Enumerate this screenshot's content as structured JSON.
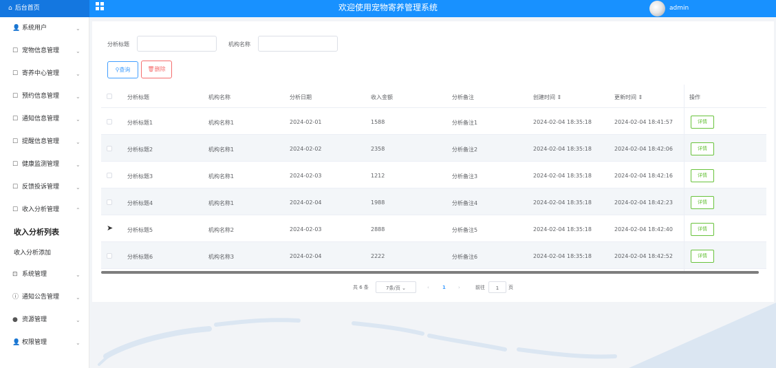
{
  "header": {
    "home_label": "后台首页",
    "title": "欢迎使用宠物寄养管理系统",
    "user": "admin"
  },
  "sidebar": {
    "items": [
      {
        "label": "系统用户",
        "icon": "user-icon",
        "glyph": "👤",
        "expanded": false
      },
      {
        "label": "宠物信息管理",
        "icon": "document-icon",
        "glyph": "☐",
        "expanded": false
      },
      {
        "label": "寄养中心管理",
        "icon": "document-icon",
        "glyph": "☐",
        "expanded": false
      },
      {
        "label": "预约信息管理",
        "icon": "document-icon",
        "glyph": "☐",
        "expanded": false
      },
      {
        "label": "通知信息管理",
        "icon": "document-icon",
        "glyph": "☐",
        "expanded": false
      },
      {
        "label": "提醒信息管理",
        "icon": "document-icon",
        "glyph": "☐",
        "expanded": false
      },
      {
        "label": "健康监测管理",
        "icon": "document-icon",
        "glyph": "☐",
        "expanded": false
      },
      {
        "label": "反馈投诉管理",
        "icon": "document-icon",
        "glyph": "☐",
        "expanded": false
      },
      {
        "label": "收入分析管理",
        "icon": "document-icon",
        "glyph": "☐",
        "expanded": true
      },
      {
        "label": "系统管理",
        "icon": "picture-icon",
        "glyph": "⊡",
        "expanded": false
      },
      {
        "label": "通知公告管理",
        "icon": "info-icon",
        "glyph": "ⓘ",
        "expanded": false
      },
      {
        "label": "资源管理",
        "icon": "location-icon",
        "glyph": "●",
        "expanded": false
      },
      {
        "label": "权限管理",
        "icon": "user-icon",
        "glyph": "👤",
        "expanded": false
      }
    ],
    "sub_items": [
      {
        "label": "收入分析列表",
        "active": true
      },
      {
        "label": "收入分析添加",
        "active": false
      }
    ],
    "chev_down": "⌄",
    "chev_up": "⌃"
  },
  "search": {
    "title_label": "分析标题",
    "title_value": "",
    "org_label": "机构名称",
    "org_value": "",
    "query_label": "查询",
    "delete_label": "删除"
  },
  "table": {
    "columns": [
      "分析标题",
      "机构名称",
      "分析日期",
      "收入金额",
      "分析备注",
      "创建时间 ⇕",
      "更新时间 ⇕",
      "操作"
    ],
    "rows": [
      [
        "分析标题1",
        "机构名称1",
        "2024-02-01",
        "1588",
        "分析备注1",
        "2024-02-04 18:35:18",
        "2024-02-04 18:41:57"
      ],
      [
        "分析标题2",
        "机构名称1",
        "2024-02-02",
        "2358",
        "分析备注2",
        "2024-02-04 18:35:18",
        "2024-02-04 18:42:06"
      ],
      [
        "分析标题3",
        "机构名称1",
        "2024-02-03",
        "1212",
        "分析备注3",
        "2024-02-04 18:35:18",
        "2024-02-04 18:42:16"
      ],
      [
        "分析标题4",
        "机构名称1",
        "2024-02-04",
        "1988",
        "分析备注4",
        "2024-02-04 18:35:18",
        "2024-02-04 18:42:23"
      ],
      [
        "分析标题5",
        "机构名称2",
        "2024-02-03",
        "2888",
        "分析备注5",
        "2024-02-04 18:35:18",
        "2024-02-04 18:42:40"
      ],
      [
        "分析标题6",
        "机构名称3",
        "2024-02-04",
        "2222",
        "分析备注6",
        "2024-02-04 18:35:18",
        "2024-02-04 18:42:52"
      ]
    ],
    "detail_label": "详情"
  },
  "pagination": {
    "total": "共 6 条",
    "page_size": "7条/页",
    "prev": "‹",
    "current": "1",
    "next": "›",
    "goto_label": "前往",
    "goto_value": "1",
    "page_unit": "页"
  },
  "colors": {
    "accent": "#1891ff",
    "danger": "#f56c6c",
    "success": "#67c23a"
  }
}
